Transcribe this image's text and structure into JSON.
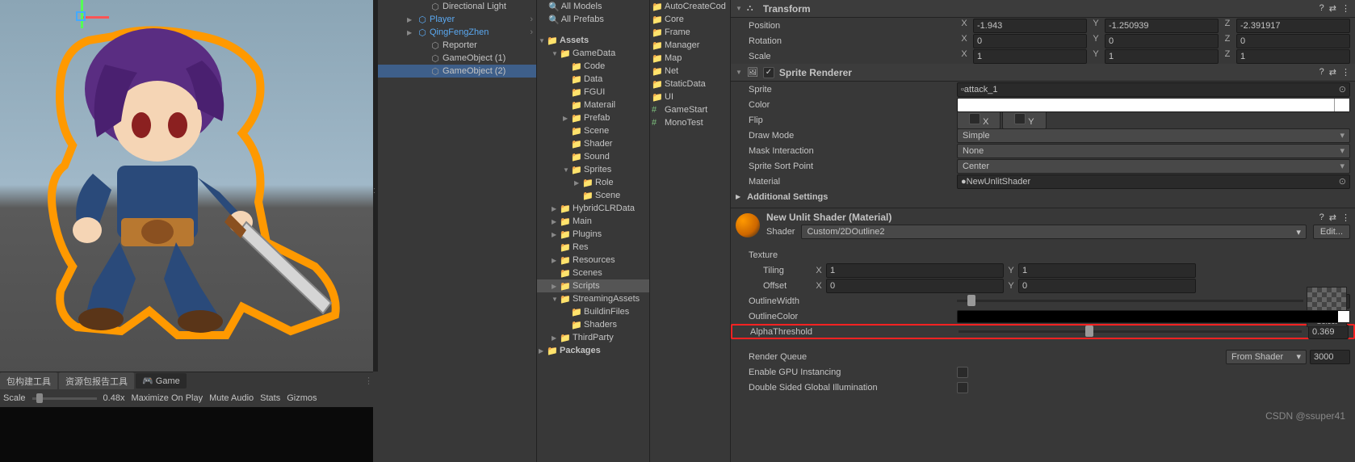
{
  "hierarchy": {
    "items": [
      {
        "name": "Directional Light",
        "icon": "cube"
      },
      {
        "name": "Player",
        "icon": "cube-blue",
        "prefab": true,
        "expandable": true
      },
      {
        "name": "QingFengZhen",
        "icon": "cube-blue",
        "prefab": true,
        "expandable": true
      },
      {
        "name": "Reporter",
        "icon": "cube"
      },
      {
        "name": "GameObject (1)",
        "icon": "cube"
      },
      {
        "name": "GameObject (2)",
        "icon": "cube",
        "selected": true
      }
    ]
  },
  "project_search": {
    "items": [
      "All Models",
      "All Prefabs"
    ]
  },
  "assets_root": "Assets",
  "assets": [
    {
      "name": "GameData",
      "lvl": 1,
      "open": true
    },
    {
      "name": "Code",
      "lvl": 2
    },
    {
      "name": "Data",
      "lvl": 2
    },
    {
      "name": "FGUI",
      "lvl": 2
    },
    {
      "name": "Materail",
      "lvl": 2
    },
    {
      "name": "Prefab",
      "lvl": 2,
      "exp": true
    },
    {
      "name": "Scene",
      "lvl": 2
    },
    {
      "name": "Shader",
      "lvl": 2
    },
    {
      "name": "Sound",
      "lvl": 2
    },
    {
      "name": "Sprites",
      "lvl": 2,
      "open": true
    },
    {
      "name": "Role",
      "lvl": 3,
      "exp": true
    },
    {
      "name": "Scene",
      "lvl": 3
    },
    {
      "name": "HybridCLRData",
      "lvl": 1,
      "exp": true
    },
    {
      "name": "Main",
      "lvl": 1,
      "exp": true
    },
    {
      "name": "Plugins",
      "lvl": 1,
      "exp": true
    },
    {
      "name": "Res",
      "lvl": 1
    },
    {
      "name": "Resources",
      "lvl": 1,
      "exp": true
    },
    {
      "name": "Scenes",
      "lvl": 1
    },
    {
      "name": "Scripts",
      "lvl": 1,
      "exp": true,
      "sel": true
    },
    {
      "name": "StreamingAssets",
      "lvl": 1,
      "open": true
    },
    {
      "name": "BuildinFiles",
      "lvl": 2
    },
    {
      "name": "Shaders",
      "lvl": 2
    },
    {
      "name": "ThirdParty",
      "lvl": 1,
      "exp": true
    }
  ],
  "packages": "Packages",
  "folders": [
    {
      "name": "AutoCreateCod",
      "type": "folder"
    },
    {
      "name": "Core",
      "type": "folder"
    },
    {
      "name": "Frame",
      "type": "folder"
    },
    {
      "name": "Manager",
      "type": "folder"
    },
    {
      "name": "Map",
      "type": "folder"
    },
    {
      "name": "Net",
      "type": "folder"
    },
    {
      "name": "StaticData",
      "type": "folder"
    },
    {
      "name": "UI",
      "type": "folder"
    },
    {
      "name": "GameStart",
      "type": "cs"
    },
    {
      "name": "MonoTest",
      "type": "cs"
    }
  ],
  "transform": {
    "title": "Transform",
    "position": {
      "label": "Position",
      "x": "-1.943",
      "y": "-1.250939",
      "z": "-2.391917"
    },
    "rotation": {
      "label": "Rotation",
      "x": "0",
      "y": "0",
      "z": "0"
    },
    "scale": {
      "label": "Scale",
      "x": "1",
      "y": "1",
      "z": "1"
    }
  },
  "sprite_renderer": {
    "title": "Sprite Renderer",
    "sprite": {
      "label": "Sprite",
      "value": "attack_1"
    },
    "color": {
      "label": "Color"
    },
    "flip": {
      "label": "Flip",
      "x": "X",
      "y": "Y"
    },
    "draw_mode": {
      "label": "Draw Mode",
      "value": "Simple"
    },
    "mask": {
      "label": "Mask Interaction",
      "value": "None"
    },
    "sort": {
      "label": "Sprite Sort Point",
      "value": "Center"
    },
    "material": {
      "label": "Material",
      "value": "NewUnlitShader"
    },
    "additional": "Additional Settings"
  },
  "material": {
    "title": "New Unlit Shader (Material)",
    "shader_label": "Shader",
    "shader": "Custom/2DOutline2",
    "edit": "Edit...",
    "texture": "Texture",
    "tiling": {
      "label": "Tiling",
      "x": "1",
      "y": "1"
    },
    "offset": {
      "label": "Offset",
      "x": "0",
      "y": "0"
    },
    "outline_width": {
      "label": "OutlineWidth",
      "value": "0.17",
      "pos": 3
    },
    "outline_color": {
      "label": "OutlineColor"
    },
    "alpha": {
      "label": "AlphaThreshold",
      "value": "0.369",
      "pos": 37
    },
    "render_queue": {
      "label": "Render Queue",
      "mode": "From Shader",
      "value": "3000"
    },
    "gpu_inst": "Enable GPU Instancing",
    "double_sided": "Double Sided Global Illumination",
    "select": "Select"
  },
  "toolbar": {
    "btn1": "包构建工具",
    "btn2": "资源包报告工具",
    "game": "Game",
    "scale": "Scale",
    "scale_val": "0.48x",
    "maximize": "Maximize On Play",
    "mute": "Mute Audio",
    "stats": "Stats",
    "gizmos": "Gizmos"
  },
  "watermark": "CSDN @ssuper41"
}
